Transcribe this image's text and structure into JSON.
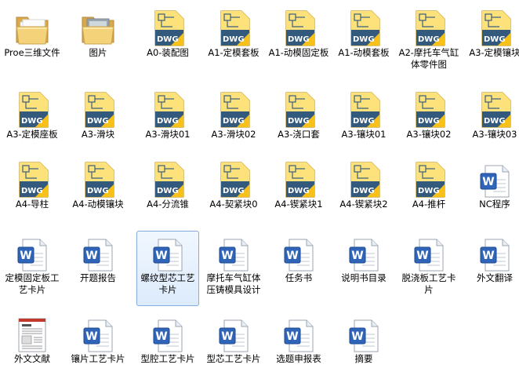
{
  "items": [
    {
      "label": "Proe三维文件",
      "type": "folder"
    },
    {
      "label": "图片",
      "type": "folder"
    },
    {
      "label": "A0-装配图",
      "type": "dwg"
    },
    {
      "label": "A1-定模套板",
      "type": "dwg"
    },
    {
      "label": "A1-动模固定板",
      "type": "dwg"
    },
    {
      "label": "A1-动模套板",
      "type": "dwg"
    },
    {
      "label": "A2-摩托车气缸体零件图",
      "type": "dwg"
    },
    {
      "label": "A3-定模镶块",
      "type": "dwg"
    },
    {
      "label": "A3-定模座板",
      "type": "dwg"
    },
    {
      "label": "A3-滑块",
      "type": "dwg"
    },
    {
      "label": "A3-滑块01",
      "type": "dwg"
    },
    {
      "label": "A3-滑块02",
      "type": "dwg"
    },
    {
      "label": "A3-浇口套",
      "type": "dwg"
    },
    {
      "label": "A3-镶块01",
      "type": "dwg"
    },
    {
      "label": "A3-镶块02",
      "type": "dwg"
    },
    {
      "label": "A3-镶块03",
      "type": "dwg"
    },
    {
      "label": "A4-导柱",
      "type": "dwg"
    },
    {
      "label": "A4-动模镶块",
      "type": "dwg"
    },
    {
      "label": "A4-分流锥",
      "type": "dwg"
    },
    {
      "label": "A4-契紧块0",
      "type": "dwg"
    },
    {
      "label": "A4-锲紧块1",
      "type": "dwg"
    },
    {
      "label": "A4-锲紧块2",
      "type": "dwg"
    },
    {
      "label": "A4-推杆",
      "type": "dwg"
    },
    {
      "label": "NC程序",
      "type": "word"
    },
    {
      "label": "定模固定板工艺卡片",
      "type": "word"
    },
    {
      "label": "开题报告",
      "type": "word"
    },
    {
      "label": "螺纹型芯工艺卡片",
      "type": "word",
      "selected": true
    },
    {
      "label": "摩托车气缸体压铸模具设计",
      "type": "word"
    },
    {
      "label": "任务书",
      "type": "word"
    },
    {
      "label": "说明书目录",
      "type": "word"
    },
    {
      "label": "脱浇板工艺卡片",
      "type": "word"
    },
    {
      "label": "外文翻译",
      "type": "word"
    },
    {
      "label": "外文文献",
      "type": "pdfdoc"
    },
    {
      "label": "镶片工艺卡片",
      "type": "word"
    },
    {
      "label": "型腔工艺卡片",
      "type": "word"
    },
    {
      "label": "型芯工艺卡片",
      "type": "word"
    },
    {
      "label": "选题申报表",
      "type": "word"
    },
    {
      "label": "摘要",
      "type": "word"
    }
  ],
  "icon_names": {
    "folder": "folder-icon",
    "dwg": "dwg-file-icon",
    "word": "word-document-icon",
    "pdfdoc": "document-thumbnail-icon"
  },
  "icon_text": {
    "dwg": "DWG",
    "word": "W"
  }
}
